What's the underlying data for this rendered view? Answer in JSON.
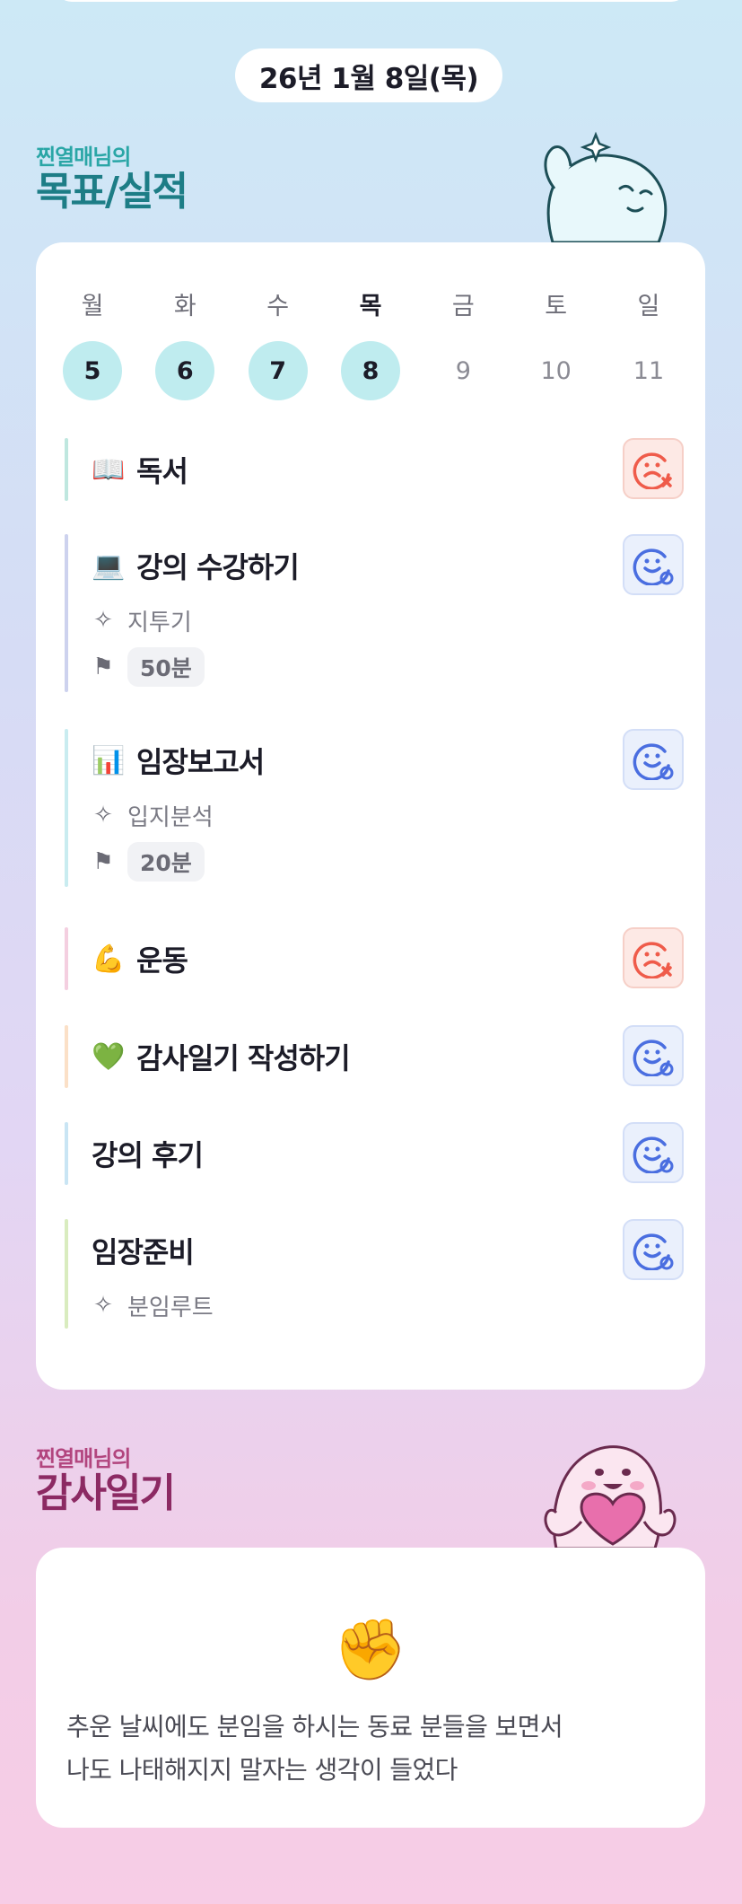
{
  "date_label": "26년 1월 8일(목)",
  "goals_section": {
    "subtitle": "찐열매님의",
    "title": "목표/실적"
  },
  "week": [
    {
      "name": "월",
      "date": "5",
      "done": true
    },
    {
      "name": "화",
      "date": "6",
      "done": true
    },
    {
      "name": "수",
      "date": "7",
      "done": true
    },
    {
      "name": "목",
      "date": "8",
      "done": true,
      "today": true
    },
    {
      "name": "금",
      "date": "9",
      "done": false
    },
    {
      "name": "토",
      "date": "10",
      "done": false
    },
    {
      "name": "일",
      "date": "11",
      "done": false
    }
  ],
  "goals": [
    {
      "emoji": "📖",
      "title": "독서",
      "status": "fail",
      "bar_color": "#bfe7df"
    },
    {
      "emoji": "💻",
      "title": "강의 수강하기",
      "status": "done",
      "bar_color": "#cdd2ee",
      "category": "지투기",
      "duration": "50분"
    },
    {
      "emoji": "📊",
      "title": "임장보고서",
      "status": "done",
      "bar_color": "#c9ecf0",
      "category": "입지분석",
      "duration": "20분"
    },
    {
      "emoji": "💪",
      "title": "운동",
      "status": "fail",
      "bar_color": "#f4cfe0"
    },
    {
      "emoji": "💚",
      "title": "감사일기 작성하기",
      "status": "done",
      "bar_color": "#fbe0c7"
    },
    {
      "emoji": "",
      "title": "강의 후기",
      "status": "done",
      "bar_color": "#c9e5f4"
    },
    {
      "emoji": "",
      "title": "임장준비",
      "status": "done",
      "bar_color": "#d9ecbf",
      "category": "분임루트"
    }
  ],
  "icons": {
    "category": "sparkle-icon",
    "duration": "flag-icon",
    "done": "smile-check-icon",
    "fail": "sad-x-icon"
  },
  "colors": {
    "done_blue": "#4a6ee0",
    "fail_red": "#ef5b4a",
    "today_circle": "#bfecef"
  },
  "diary_section": {
    "subtitle": "찐열매님의",
    "title": "감사일기"
  },
  "diary": {
    "emoji": "✊",
    "line1": "추운 날씨에도 분임을 하시는 동료 분들을 보면서",
    "line2": "나도 나태해지지 말자는 생각이 들었다"
  }
}
